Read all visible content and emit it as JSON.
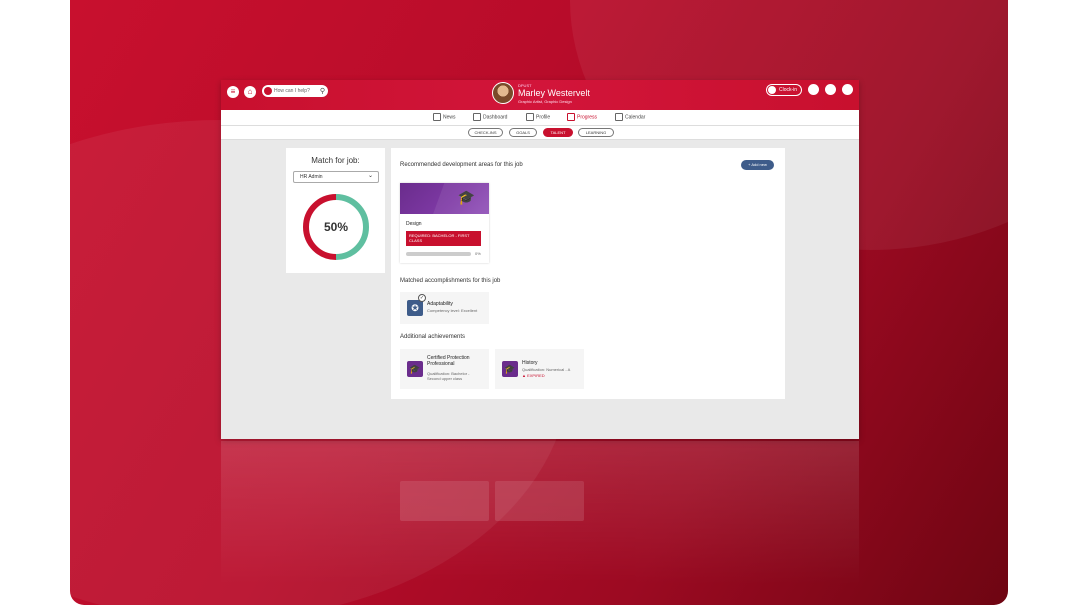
{
  "topbar": {
    "search_placeholder": "How can I help?",
    "profile_small": "DPUST",
    "user_name": "Marley Westervelt",
    "user_role": "Graphic Artist, Graphic Design",
    "clockin_label": "Clock-in"
  },
  "nav": {
    "items": [
      {
        "label": "News",
        "icon": "news-icon"
      },
      {
        "label": "Dashboard",
        "icon": "star-icon"
      },
      {
        "label": "Profile",
        "icon": "person-icon"
      },
      {
        "label": "Progress",
        "icon": "chart-icon"
      },
      {
        "label": "Calendar",
        "icon": "calendar-icon"
      }
    ],
    "active": "Progress"
  },
  "subnav": {
    "pills": [
      "CHECK-INS",
      "GOALS",
      "TALENT",
      "LEARNING"
    ],
    "active": "TALENT"
  },
  "match": {
    "title": "Match for job:",
    "selected_job": "HR Admin",
    "percent_label": "50%",
    "percent": 50,
    "colors": {
      "matched": "#5fbfa0",
      "unmatched": "#c8102e"
    }
  },
  "recommended": {
    "title": "Recommended development areas for this job",
    "add_button": "+ Add new",
    "card": {
      "name": "Design",
      "tag": "REQUIRED: BACHELOR - FIRST CLASS",
      "progress_label": "0%",
      "progress": 0
    }
  },
  "matched": {
    "title": "Matched accomplishments for this job",
    "items": [
      {
        "title": "Adaptability",
        "sub": "Competency level: Excellent"
      }
    ]
  },
  "additional": {
    "title": "Additional achievements",
    "items": [
      {
        "title": "Certified Protection Professional",
        "sub": "Qualification: Bachelor - Second upper class"
      },
      {
        "title": "History",
        "sub": "Qualification: Numerical - A",
        "status": "EXPIRED"
      }
    ]
  },
  "colors": {
    "brand": "#c8102e",
    "accent_blue": "#3e5c8a",
    "purple": "#6a2c8c"
  }
}
